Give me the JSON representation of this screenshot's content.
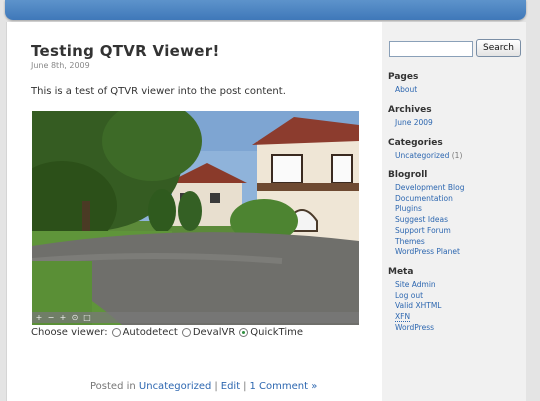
{
  "post": {
    "title": "Testing QTVR Viewer!",
    "date": "June 8th, 2009",
    "text": "This is a test of QTVR viewer into the post content.",
    "viewer_prompt": "Choose viewer:",
    "viewer_options": [
      "Autodetect",
      "DevalVR",
      "QuickTime"
    ],
    "viewer_selected": "QuickTime",
    "meta": {
      "posted_in": "Posted in",
      "category": "Uncategorized",
      "edit": "Edit",
      "comments": "1 Comment »"
    }
  },
  "pano_controls": [
    "+",
    "−",
    "+",
    "⊙",
    "□"
  ],
  "sidebar": {
    "search_button": "Search",
    "pages_title": "Pages",
    "pages": [
      "About"
    ],
    "archives_title": "Archives",
    "archives": [
      "June 2009"
    ],
    "categories_title": "Categories",
    "categories": [
      {
        "name": "Uncategorized",
        "count": "(1)"
      }
    ],
    "blogroll_title": "Blogroll",
    "blogroll": [
      "Development Blog",
      "Documentation",
      "Plugins",
      "Suggest Ideas",
      "Support Forum",
      "Themes",
      "WordPress Planet"
    ],
    "meta_title": "Meta",
    "meta_links": [
      "Site Admin",
      "Log out",
      "Valid XHTML",
      "XFN",
      "WordPress"
    ]
  },
  "colors": {
    "header": "#4a84c2",
    "link": "#2d67b0",
    "sidebar_bg": "#f1f1f1"
  }
}
